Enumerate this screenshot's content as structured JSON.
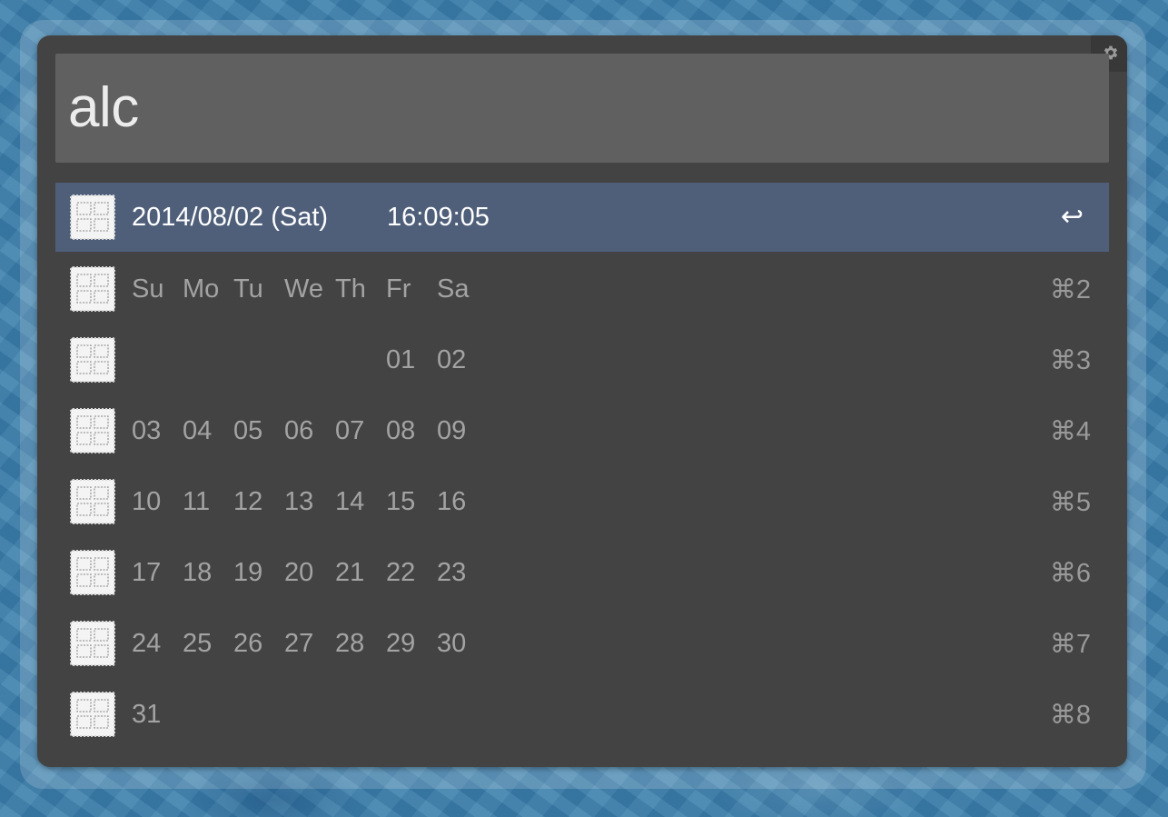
{
  "search": {
    "query": "alc"
  },
  "results": [
    {
      "date": "2014/08/02 (Sat)",
      "time": "16:09:05",
      "shortcut": "↩",
      "selected": true
    },
    {
      "cells": [
        "Su",
        "Mo",
        "Tu",
        "We",
        "Th",
        "Fr",
        "Sa"
      ],
      "shortcut": "⌘2"
    },
    {
      "cells": [
        "",
        "",
        "",
        "",
        "",
        "01",
        "02"
      ],
      "shortcut": "⌘3"
    },
    {
      "cells": [
        "03",
        "04",
        "05",
        "06",
        "07",
        "08",
        "09"
      ],
      "shortcut": "⌘4"
    },
    {
      "cells": [
        "10",
        "11",
        "12",
        "13",
        "14",
        "15",
        "16"
      ],
      "shortcut": "⌘5"
    },
    {
      "cells": [
        "17",
        "18",
        "19",
        "20",
        "21",
        "22",
        "23"
      ],
      "shortcut": "⌘6"
    },
    {
      "cells": [
        "24",
        "25",
        "26",
        "27",
        "28",
        "29",
        "30"
      ],
      "shortcut": "⌘7"
    },
    {
      "cells": [
        "31",
        "",
        "",
        "",
        "",
        "",
        ""
      ],
      "shortcut": "⌘8"
    }
  ],
  "colors": {
    "window_bg": "#434343",
    "search_bg": "#606060",
    "selected_bg": "#4f5f7a",
    "text_muted": "#a3a3a3"
  },
  "icons": {
    "result_icon": "calendar-grid-icon",
    "settings": "gear-icon"
  }
}
